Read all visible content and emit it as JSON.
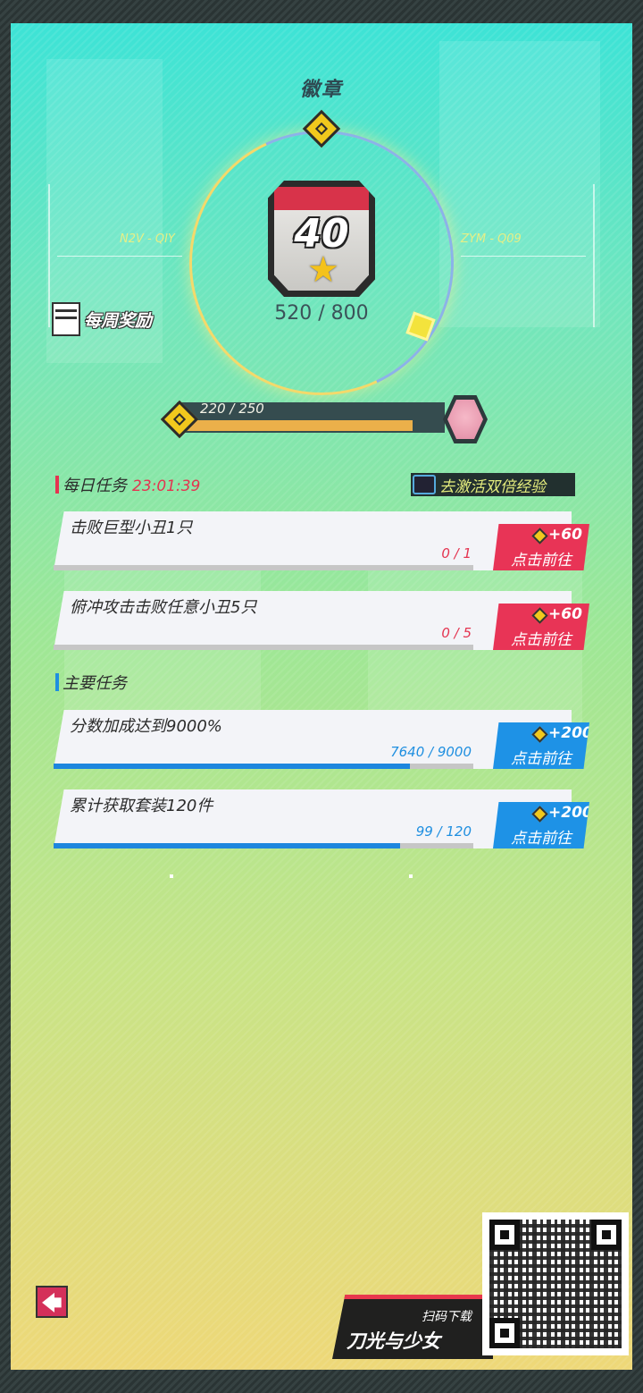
{
  "title": "徽章",
  "badge": {
    "level": "40",
    "exp_text": "520 / 800"
  },
  "side_labels": {
    "left": "N2V - QIY",
    "right": "ZYM - Q09"
  },
  "weekly": {
    "label": "每周奖励",
    "icon": "calendar-icon"
  },
  "level_bar": {
    "text": "220 / 250",
    "current": 220,
    "max": 250
  },
  "daily": {
    "header": "每日任务",
    "timer": "23:01:39",
    "double_exp_label": "去激活双倍经验",
    "accent": "#e43450",
    "tasks": [
      {
        "name": "击败巨型小丑1只",
        "progress": "0 / 1",
        "current": 0,
        "max": 1,
        "reward": "+60",
        "action": "点击前往"
      },
      {
        "name": "俯冲攻击击败任意小丑5只",
        "progress": "0 / 5",
        "current": 0,
        "max": 5,
        "reward": "+60",
        "action": "点击前往"
      }
    ]
  },
  "main": {
    "header": "主要任务",
    "accent": "#1f8fe0",
    "tasks": [
      {
        "name": "分数加成达到9000%",
        "progress": "7640 / 9000",
        "current": 7640,
        "max": 9000,
        "reward": "+200",
        "action": "点击前往"
      },
      {
        "name": "累计获取套装120件",
        "progress": "99 / 120",
        "current": 99,
        "max": 120,
        "reward": "+200",
        "action": "点击前往"
      }
    ]
  },
  "back_button": {
    "icon": "back-arrow-icon",
    "glyph": "🡄"
  },
  "promo": {
    "scan_label": "扫码下载",
    "game_name": "刀光与少女"
  },
  "colors": {
    "daily_button": "#e83456",
    "main_button": "#1e92e6",
    "main_fill": "#1d86de"
  }
}
